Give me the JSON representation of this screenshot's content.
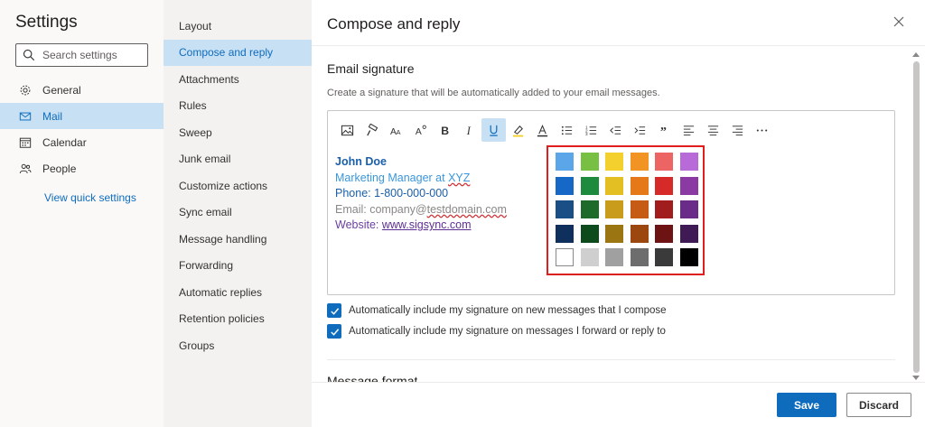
{
  "settings": {
    "title": "Settings",
    "search_placeholder": "Search settings",
    "nav": [
      {
        "label": "General",
        "icon": "gear-icon"
      },
      {
        "label": "Mail",
        "icon": "mail-icon",
        "active": true
      },
      {
        "label": "Calendar",
        "icon": "calendar-icon"
      },
      {
        "label": "People",
        "icon": "people-icon"
      }
    ],
    "quick_settings": "View quick settings"
  },
  "mail_nav": [
    {
      "label": "Layout"
    },
    {
      "label": "Compose and reply",
      "active": true
    },
    {
      "label": "Attachments"
    },
    {
      "label": "Rules"
    },
    {
      "label": "Sweep"
    },
    {
      "label": "Junk email"
    },
    {
      "label": "Customize actions"
    },
    {
      "label": "Sync email"
    },
    {
      "label": "Message handling"
    },
    {
      "label": "Forwarding"
    },
    {
      "label": "Automatic replies"
    },
    {
      "label": "Retention policies"
    },
    {
      "label": "Groups"
    }
  ],
  "pane": {
    "title": "Compose and reply",
    "section_title": "Email signature",
    "section_desc": "Create a signature that will be automatically added to your email messages.",
    "next_section": "Message format"
  },
  "toolbar": [
    "picture-icon",
    "format-painter-icon",
    "font-size-icon",
    "grow-font-icon",
    "bold-icon",
    "italic-icon",
    "underline-icon",
    "highlight-icon",
    "font-color-icon",
    "bullets-icon",
    "numbering-icon",
    "outdent-icon",
    "indent-icon",
    "quote-icon",
    "align-left-icon",
    "align-center-icon",
    "align-right-icon",
    "more-icon"
  ],
  "signature": {
    "name": "John Doe",
    "title_prefix": "Marketing Manager at ",
    "title_company": "XYZ",
    "phone": "Phone: 1-800-000-000",
    "email_prefix": "Email: company@",
    "email_domain": "testdomain.com",
    "web_prefix": "Website: ",
    "web_link": "www.sigsync.com"
  },
  "palette": [
    [
      "#5aa6e8",
      "#78c043",
      "#f3d02d",
      "#f29424",
      "#ed6464",
      "#b96ad9"
    ],
    [
      "#1668c6",
      "#1d8a3d",
      "#e3bf23",
      "#e57818",
      "#d62a28",
      "#8b3aa3"
    ],
    [
      "#1a4f86",
      "#1e6a2a",
      "#c99c1c",
      "#c55b15",
      "#a11c1c",
      "#6b2c89"
    ],
    [
      "#0f2f5c",
      "#0d4a1c",
      "#9b7512",
      "#9c4610",
      "#6e1313",
      "#3f1a55"
    ],
    [
      "#ffffff",
      "#cfcfcf",
      "#a0a0a0",
      "#6d6d6d",
      "#3a3a3a",
      "#000000"
    ]
  ],
  "options": [
    {
      "label": "Automatically include my signature on new messages that I compose",
      "checked": true
    },
    {
      "label": "Automatically include my signature on messages I forward or reply to",
      "checked": true
    }
  ],
  "buttons": {
    "save": "Save",
    "discard": "Discard"
  }
}
